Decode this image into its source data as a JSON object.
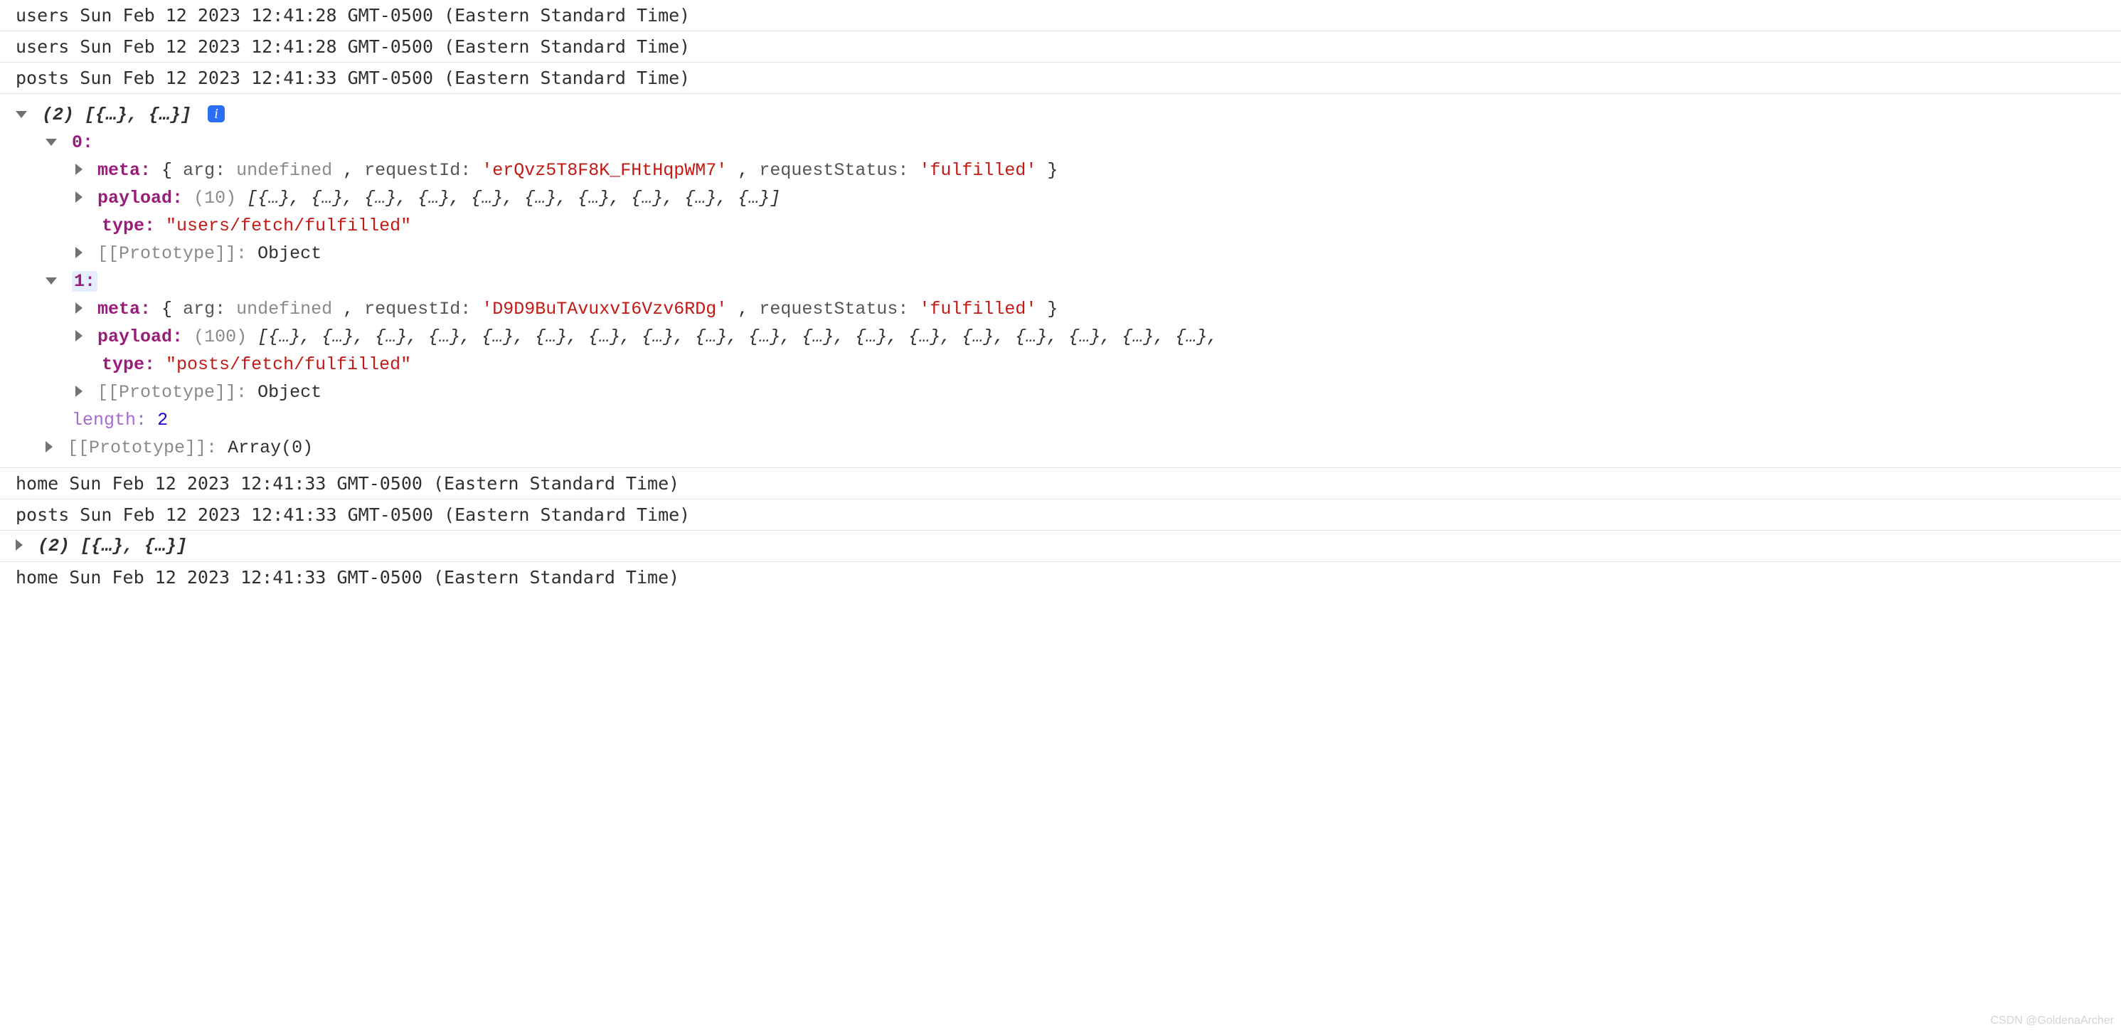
{
  "logs": {
    "top": [
      "users Sun Feb 12 2023 12:41:28 GMT-0500 (Eastern Standard Time)",
      "users Sun Feb 12 2023 12:41:28 GMT-0500 (Eastern Standard Time)",
      "posts Sun Feb 12 2023 12:41:33 GMT-0500 (Eastern Standard Time)"
    ],
    "mid": [
      "home Sun Feb 12 2023 12:41:33 GMT-0500 (Eastern Standard Time)",
      "posts Sun Feb 12 2023 12:41:33 GMT-0500 (Eastern Standard Time)"
    ],
    "bottom": [
      "home Sun Feb 12 2023 12:41:33 GMT-0500 (Eastern Standard Time)"
    ]
  },
  "expanded": {
    "summary": "(2) [{…}, {…}]",
    "info_glyph": "i",
    "items": [
      {
        "index_label": "0:",
        "meta": {
          "key": "meta:",
          "open": "{",
          "arg_key": "arg:",
          "arg_val": "undefined",
          "sep1": ", ",
          "reqId_key": "requestId:",
          "reqId_val": "'erQvz5T8F8K_FHtHqpWM7'",
          "sep2": ", ",
          "reqStatus_key": "requestStatus:",
          "reqStatus_val": "'fulfilled'",
          "close": "}"
        },
        "payload": {
          "key": "payload:",
          "count": "(10)",
          "preview": "[{…}, {…}, {…}, {…}, {…}, {…}, {…}, {…}, {…}, {…}]"
        },
        "type": {
          "key": "type:",
          "val": "\"users/fetch/fulfilled\""
        },
        "proto": {
          "label": "[[Prototype]]:",
          "value": "Object"
        }
      },
      {
        "index_label": "1:",
        "meta": {
          "key": "meta:",
          "open": "{",
          "arg_key": "arg:",
          "arg_val": "undefined",
          "sep1": ", ",
          "reqId_key": "requestId:",
          "reqId_val": "'D9D9BuTAvuxvI6Vzv6RDg'",
          "sep2": ", ",
          "reqStatus_key": "requestStatus:",
          "reqStatus_val": "'fulfilled'",
          "close": "}"
        },
        "payload": {
          "key": "payload:",
          "count": "(100)",
          "preview": "[{…}, {…}, {…}, {…}, {…}, {…}, {…}, {…}, {…}, {…}, {…}, {…}, {…}, {…}, {…}, {…}, {…}, {…},"
        },
        "type": {
          "key": "type:",
          "val": "\"posts/fetch/fulfilled\""
        },
        "proto": {
          "label": "[[Prototype]]:",
          "value": "Object"
        }
      }
    ],
    "length": {
      "key": "length:",
      "val": "2"
    },
    "arr_proto": {
      "label": "[[Prototype]]:",
      "value": "Array(0)"
    }
  },
  "collapsed": {
    "summary": "(2) [{…}, {…}]"
  },
  "watermark": "CSDN @GoldenaArcher"
}
